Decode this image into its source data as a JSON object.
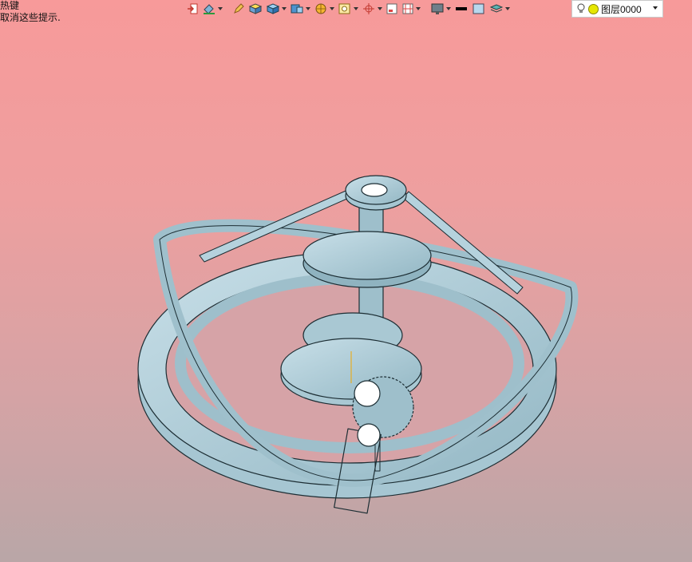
{
  "hint": {
    "line1": "热键",
    "line2": "取消这些提示."
  },
  "toolbar": {
    "icons": [
      "exit-view-icon",
      "paint-bucket-icon",
      "pencil-icon",
      "box-shaded-icon",
      "box-blue-icon",
      "box-display-icon",
      "sphere-icon",
      "frame-icon",
      "axis-icon",
      "page-icon",
      "section-icon",
      "monitor-icon",
      "line-color-icon",
      "fill-color-icon",
      "layers-icon"
    ],
    "colors": {
      "model": "#b5d2dd",
      "model_dark": "#8fb3c0",
      "model_edge": "#1c2d33",
      "accent_orange": "#f2a700"
    }
  },
  "layer": {
    "value": "图层0000"
  }
}
